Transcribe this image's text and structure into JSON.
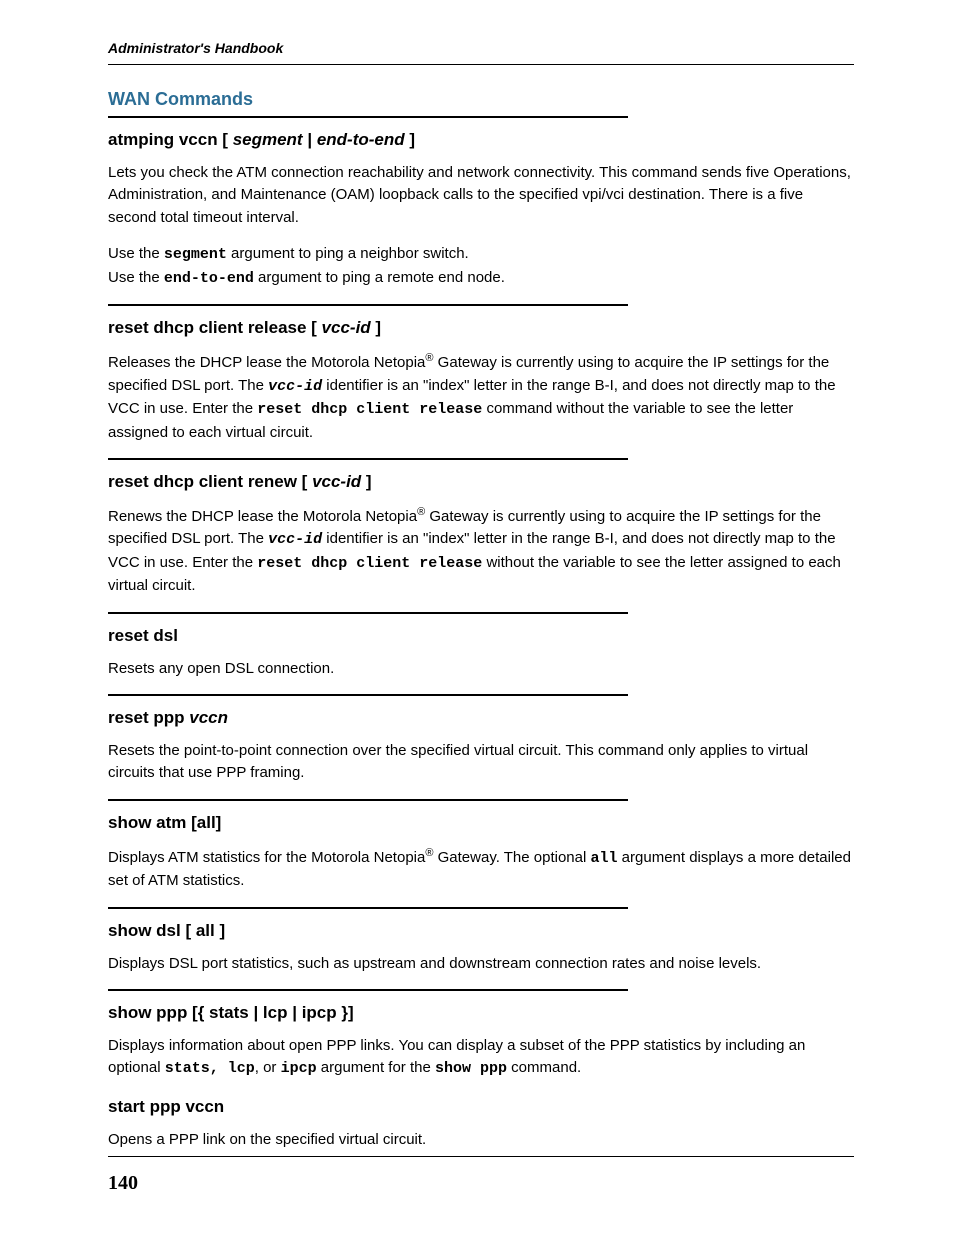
{
  "header": {
    "title": "Administrator's Handbook"
  },
  "section_title": "WAN Commands",
  "commands": [
    {
      "heading_pre": "atmping vccn [ ",
      "heading_ital": "segment",
      "heading_mid": " | ",
      "heading_ital2": "end-to-end",
      "heading_post": " ]",
      "body1": "Lets you check the ATM connection reachability and network connectivity. This command sends five Operations, Administration, and Maintenance (OAM) loopback calls to the specified vpi/vci destination. There is a five second total timeout interval.",
      "body2_pre": "Use the ",
      "body2_mono": "segment",
      "body2_post": " argument to ping a neighbor switch.",
      "body3_pre": "Use the ",
      "body3_mono": "end-to-end",
      "body3_post": " argument to ping a remote end node."
    },
    {
      "heading_pre": "reset dhcp client release [ ",
      "heading_ital": "vcc-id",
      "heading_post": " ]",
      "body1_pre": "Releases the DHCP lease the Motorola Netopia",
      "body1_sup": "®",
      "body1_mid": " Gateway is currently using to acquire the IP settings for the specified DSL port. The ",
      "body1_monoital": "vcc-id",
      "body1_mid2": " identifier is an \"index\" letter in the range B-I, and does not directly map to the VCC in use. Enter the ",
      "body1_mono": "reset dhcp client release",
      "body1_post": " command without the variable to see the letter assigned to each virtual circuit."
    },
    {
      "heading_pre": "reset dhcp client renew [ ",
      "heading_ital": "vcc-id",
      "heading_post": " ]",
      "body1_pre": "Renews the DHCP lease the Motorola Netopia",
      "body1_sup": "®",
      "body1_mid": " Gateway is currently using to acquire the IP settings for the specified DSL port. The ",
      "body1_monoital": "vcc-id",
      "body1_mid2": " identifier is an \"index\" letter in the range B-I, and does not directly map to the VCC in use. Enter the ",
      "body1_mono": "reset dhcp client release",
      "body1_post": " without the variable to see the letter assigned to each virtual circuit."
    },
    {
      "heading": "reset dsl",
      "body1": "Resets any open DSL connection."
    },
    {
      "heading_pre": "reset ppp ",
      "heading_ital": "vccn",
      "body1": "Resets the point-to-point connection over the specified virtual circuit. This command only applies to virtual circuits that use PPP framing."
    },
    {
      "heading": "show atm [all]",
      "body1_pre": "Displays ATM statistics for the Motorola Netopia",
      "body1_sup": "®",
      "body1_mid": " Gateway. The optional ",
      "body1_mono": "all",
      "body1_post": " argument displays a more detailed set of ATM statistics."
    },
    {
      "heading": "show dsl [ all ]",
      "body1": "Displays DSL port statistics, such as upstream and downstream connection rates and noise levels."
    },
    {
      "heading": "show ppp [{ stats | lcp | ipcp }]",
      "body1_pre": "Displays information about open PPP links. You can display a subset of the PPP statistics by including an optional ",
      "body1_mono": "stats, lcp",
      "body1_mid": ", or ",
      "body1_mono2": "ipcp",
      "body1_mid2": " argument for the ",
      "body1_mono3": "show ppp",
      "body1_post": " command."
    },
    {
      "heading": "start ppp vccn",
      "body1": "Opens a PPP link on the specified virtual circuit."
    }
  ],
  "page_number": "140"
}
